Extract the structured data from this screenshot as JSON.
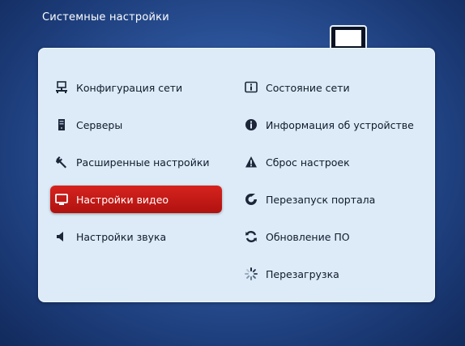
{
  "header": {
    "title": "Системные настройки"
  },
  "colors": {
    "accent": "#c41b17",
    "panel": "#dcebf7",
    "background": "#2c549a"
  },
  "menu": {
    "left": [
      {
        "label": "Конфигурация сети",
        "icon": "network-config-icon"
      },
      {
        "label": "Серверы",
        "icon": "server-icon"
      },
      {
        "label": "Расширенные настройки",
        "icon": "wrench-icon"
      },
      {
        "label": "Настройки видео",
        "icon": "monitor-icon",
        "selected": true
      },
      {
        "label": "Настройки звука",
        "icon": "speaker-icon"
      }
    ],
    "right": [
      {
        "label": "Состояние сети",
        "icon": "info-icon"
      },
      {
        "label": "Информация об устройстве",
        "icon": "device-info-icon"
      },
      {
        "label": "Сброс настроек",
        "icon": "warning-icon"
      },
      {
        "label": "Перезапуск портала",
        "icon": "restart-icon"
      },
      {
        "label": "Обновление ПО",
        "icon": "refresh-icon"
      },
      {
        "label": "Перезагрузка",
        "icon": "loading-icon"
      }
    ]
  }
}
